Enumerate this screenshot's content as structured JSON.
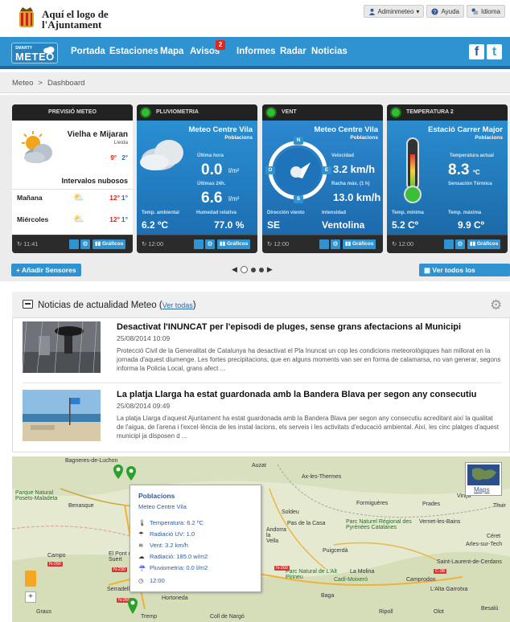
{
  "header": {
    "logo_line1": "Aquí el logo de",
    "logo_line2": "l'Ajuntament",
    "user_menu": "Adminmeteo",
    "help": "Ayuda",
    "language": "Idioma"
  },
  "nav": {
    "brand_small": "SMARTY",
    "brand_big": "METEO",
    "items": [
      "Portada",
      "Estaciones",
      "Mapa",
      "Avisos",
      "Informes",
      "Radar",
      "Noticias"
    ],
    "avisos_badge": "2",
    "facebook": "f",
    "twitter": "t"
  },
  "breadcrumb": [
    "Meteo",
    ">",
    "Dashboard"
  ],
  "widgets": {
    "forecast": {
      "title": "PREVISIÓ METEO",
      "location": "Vielha e Mijaran",
      "region": "Lleida",
      "temp_max": "9°",
      "temp_min": "2°",
      "condition": "Intervalos nubosos",
      "day1": "Mañana",
      "day1_max": "12°",
      "day1_min": "1°",
      "day2": "Miércoles",
      "day2_max": "12°",
      "day2_min": "1°",
      "time": "11:41",
      "graphs": "Gráficos"
    },
    "rain": {
      "title": "PLUVIOMETRIA",
      "station": "Meteo Centre Vila",
      "type": "Poblacions",
      "label_hour": "Última hora",
      "value_hour": "0.0",
      "unit_hour": "l/m²",
      "label_day": "Últimas 24h.",
      "value_day": "6.6",
      "unit_day": "l/m²",
      "label_temp": "Temp. ambiental",
      "value_temp": "6.2 ºC",
      "label_hum": "Humedad relativa",
      "value_hum": "77.0 %",
      "time": "12:00",
      "graphs": "Gráficos"
    },
    "wind": {
      "title": "VENT",
      "station": "Meteo Centre Vila",
      "type": "Poblacions",
      "compass_n": "N",
      "compass_s": "S",
      "compass_e": "E",
      "compass_o": "O",
      "label_speed": "Velocidad",
      "value_speed": "3.2 km/h",
      "label_gust": "Racha máx. (1 h)",
      "value_gust": "13.0 km/h",
      "label_dir": "Dirección viento",
      "value_dir": "SE",
      "label_int": "Intensidad",
      "value_int": "Ventolina",
      "time": "12:00",
      "graphs": "Gráficos"
    },
    "temp": {
      "title": "TEMPERATURA 2",
      "station": "Estació Carrer Major",
      "type": "Poblacions",
      "label_now": "Temperatura actual",
      "value_now": "8.3",
      "unit_now": "ºC",
      "label_feel": "Sensación Térmica",
      "label_min": "Temp. mínima",
      "value_min": "5.2 Cº",
      "label_max": "Temp. máxima",
      "value_max": "9.9 Cº",
      "time": "12:00",
      "graphs": "Gráficos"
    }
  },
  "controls": {
    "add_sensors": "Añadir Sensores",
    "view_favorites": "Ver todos los favoritos"
  },
  "news": {
    "title": "Noticias de actualidad Meteo",
    "view_all": "Ver todas",
    "items": [
      {
        "title": "Desactivat l'INUNCAT per l'episodi de pluges, sense grans afectacions al Municipi",
        "date": "25/08/2014 10:09",
        "text": "Protecció Civil de la Generalitat de Catalunya ha desactivat el Pla Inuncat un cop les condicions meteorològiques han millorat en la jornada d'aquest diumenge. Les fortes precipitacions, que en alguns moments van ser en forma de calamarsa, no van generar, segons informa la Policia Local, grans afect ..."
      },
      {
        "title": "La platja Llarga ha estat guardonada amb la Bandera Blava per segon any consecutiu",
        "date": "25/08/2014 09:49",
        "text": "La platja Llarga d'aquest Ajuntament ha estat guardonada amb la Bandera Blava per segon any consecutiu acreditant així la qualitat de l'aigua, de l'arena i l'excel·lència de les instal·lacions, els serveis i les activitats d'educació ambiental. Així, les cinc platges d'aquest municipi ja disposen d ..."
      }
    ]
  },
  "map": {
    "places": [
      "Bagneres-de-Luchon",
      "Auzat",
      "Ax-les-Thermes",
      "Parque Natural Posets-Maladeta",
      "Benasque",
      "Formiguères",
      "Prades",
      "Vinça",
      "Thuir",
      "Soldeu",
      "Pas de la Casa",
      "Parc Naturel Régional des Pyrénées Catalanes",
      "Vernet-les-Bains",
      "Céret",
      "Arles-sur-Tech",
      "Puigcerdà",
      "Campo",
      "El Pont de Suert",
      "Saint-Laurent-de-Cerdans",
      "Parc Natural de L'Alt Pirineu",
      "La Molina",
      "Camprodon",
      "Cadí-Moixeró",
      "Hortoneda",
      "Baga",
      "L'Alta Garrotxa",
      "Graus",
      "Tremp",
      "Coll de Nargó",
      "Ripoll",
      "Olot",
      "Besalú",
      "Serradell",
      "Andorra la Vella"
    ],
    "roads": [
      "N-260",
      "N-230",
      "N-260",
      "C-38",
      "N-260"
    ],
    "maps_button": "Maps",
    "popup": {
      "title": "Poblacions",
      "station": "Meteo Centre Vila",
      "temperature": "Temperatura: 6.2 ºC",
      "uv": "Radiació UV: 1.0",
      "wind": "Vent: 3.2 km/h",
      "radiation": "Radiació: 185.0 w/m2",
      "rain": "Pluviometria: 0.0 l/m2",
      "time": "12:00"
    }
  },
  "colors": {
    "nav_blue": "#2f93d1",
    "widget_dark": "#2b2b2b",
    "rain_blue": "#3aa0dc",
    "wind_blue": "#2d7fc7",
    "temp_blue": "#1e7fc4",
    "status_green": "#2ec02e",
    "badge_red": "#e3251d"
  }
}
